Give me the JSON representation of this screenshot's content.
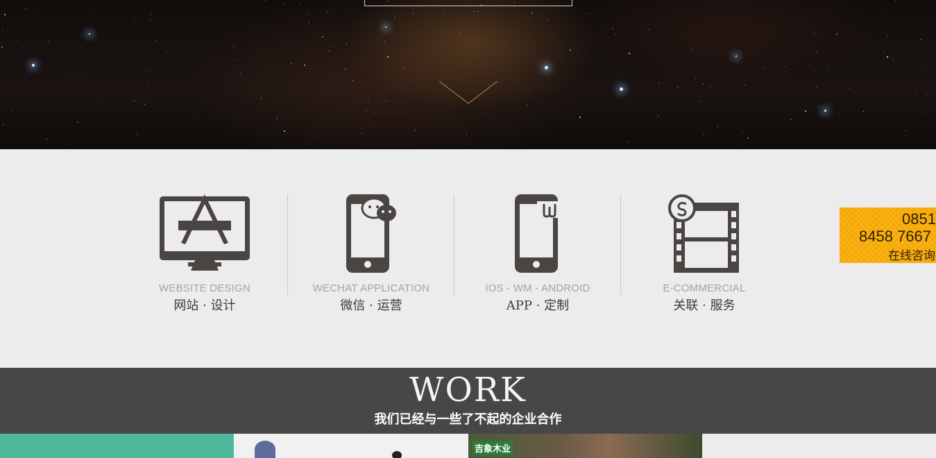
{
  "services": [
    {
      "icon": "monitor-design-icon",
      "en": "WEBSITE DESIGN",
      "cn": "网站 · 设计"
    },
    {
      "icon": "phone-wechat-icon",
      "en": "WECHAT APPLICATION",
      "cn": "微信 · 运营"
    },
    {
      "icon": "phone-app-icon",
      "en": "IOS - WM - ANDROID",
      "cn": "APP · 定制"
    },
    {
      "icon": "film-commerce-icon",
      "en": "E-COMMERCIAL",
      "cn": "关联 · 服务"
    }
  ],
  "hotline": {
    "line1": "0851",
    "line2": "8458 7667",
    "line3": "在线咨询"
  },
  "work": {
    "title": "WORK",
    "subtitle": "我们已经与一些了不起的企业合作"
  },
  "thumbs": [
    {
      "badge": ""
    },
    {
      "badge": ""
    },
    {
      "badge": "吉象木业"
    },
    {
      "badge": ""
    }
  ],
  "colors": {
    "hotline_bg": "#f6a800",
    "work_bg": "#474545",
    "icon": "#4a4543"
  }
}
